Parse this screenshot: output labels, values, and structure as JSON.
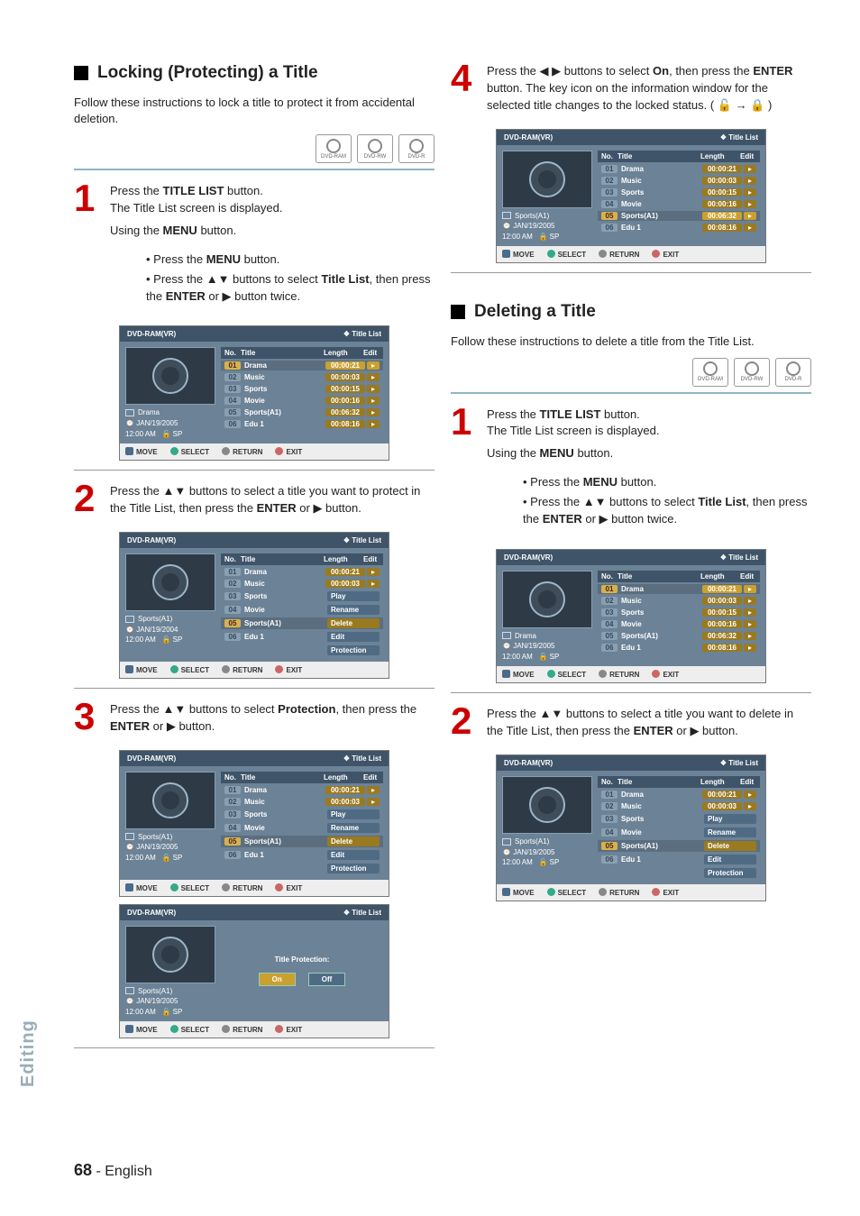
{
  "page": {
    "number": "68",
    "lang": "English"
  },
  "sidebar_label": "Editing",
  "sections": {
    "lock": {
      "heading": "Locking (Protecting) a Title",
      "intro": "Follow these instructions to lock a title to protect it from accidental deletion."
    },
    "delete": {
      "heading": "Deleting a Title",
      "intro": "Follow these instructions to delete a title from the Title List."
    }
  },
  "discs": [
    "DVD-RAM",
    "DVD-RW",
    "DVD-R"
  ],
  "steps": {
    "press_title_list_1": "Press the ",
    "title_list_btn": "TITLE LIST",
    "press_title_list_2": " button.",
    "title_list_shown": "The Title List screen is displayed.",
    "using_menu": "Using the ",
    "menu_word": "MENU",
    "using_menu_2": " button.",
    "bul_press_menu_1": "Press the ",
    "bul_press_menu_2": " button.",
    "bul_select_tl_1": "Press the ▲▼ buttons to select ",
    "title_list_word": "Title List",
    "bul_select_tl_2": ", then press the ",
    "enter_word": "ENTER",
    "bul_select_tl_3": " or ▶ button twice.",
    "lock2": "Press the ▲▼ buttons to select a title you want to protect in the Title List, then press the ",
    "lock2_end": " or ▶ button.",
    "lock3_1": "Press the ▲▼ buttons to select ",
    "protection_word": "Protection",
    "lock3_2": ", then press the ",
    "lock3_3": " or ▶ button.",
    "lock4_1": "Press the ◀ ▶ buttons to select ",
    "on_word": "On",
    "lock4_2": ", then press the ",
    "lock4_3": " button. The key icon on the information window for the selected title changes to the locked status. ( 🔓 → 🔒 )",
    "del2": "Press the ▲▼ buttons to select a title you want to delete in the Title List, then press the ",
    "del2_end": " or ▶ button."
  },
  "screen_common": {
    "device": "DVD-RAM(VR)",
    "title": "Title List",
    "cols": {
      "no": "No.",
      "title": "Title",
      "length": "Length",
      "edit": "Edit"
    },
    "bar": {
      "move": "MOVE",
      "select": "SELECT",
      "return": "RETURN",
      "exit": "EXIT"
    }
  },
  "titles": [
    {
      "no": "01",
      "title": "Drama",
      "len": "00:00:21"
    },
    {
      "no": "02",
      "title": "Music",
      "len": "00:00:03"
    },
    {
      "no": "03",
      "title": "Sports",
      "len": "00:00:15"
    },
    {
      "no": "04",
      "title": "Movie",
      "len": "00:00:16"
    },
    {
      "no": "05",
      "title": "Sports(A1)",
      "len": "00:06:32"
    },
    {
      "no": "06",
      "title": "Edu 1",
      "len": "00:08:16"
    }
  ],
  "edit_menu": [
    "Play",
    "Rename",
    "Delete",
    "Edit",
    "Protection"
  ],
  "meta_lock_step1": {
    "name": "Drama",
    "date": "JAN/19/2005",
    "time": "12:00 AM",
    "mode": "SP"
  },
  "meta_lock_step2": {
    "name": "Sports(A1)",
    "date": "JAN/19/2004",
    "time": "12:00 AM",
    "mode": "SP"
  },
  "meta_lock_step3": {
    "name": "Sports(A1)",
    "date": "JAN/19/2005",
    "time": "12:00 AM",
    "mode": "SP"
  },
  "meta_lock_prot": {
    "name": "Sports(A1)",
    "date": "JAN/19/2005",
    "time": "12:00 AM",
    "mode": "SP"
  },
  "meta_lock_step4": {
    "name": "Sports(A1)",
    "date": "JAN/19/2005",
    "time": "12:00 AM",
    "mode": "SP"
  },
  "meta_del_step1": {
    "name": "Drama",
    "date": "JAN/19/2005",
    "time": "12:00 AM",
    "mode": "SP"
  },
  "meta_del_step2": {
    "name": "Sports(A1)",
    "date": "JAN/19/2005",
    "time": "12:00 AM",
    "mode": "SP"
  },
  "prot_dialog": {
    "label": "Title Protection:",
    "on": "On",
    "off": "Off"
  }
}
